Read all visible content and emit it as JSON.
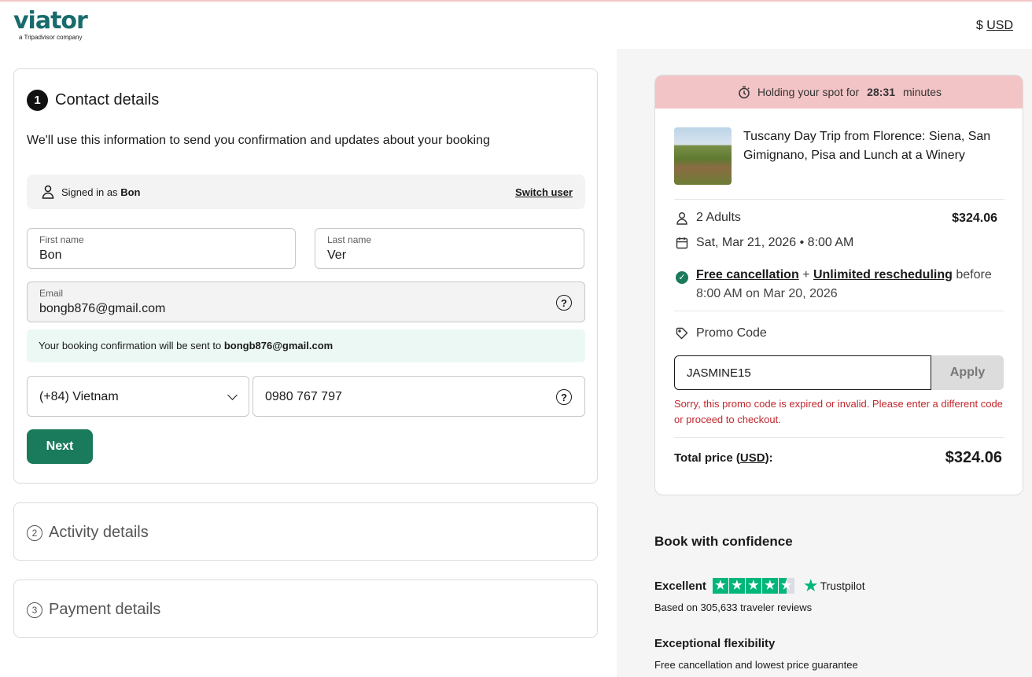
{
  "header": {
    "logo_text": "viator",
    "logo_sub": "a Tripadvisor company",
    "currency_symbol": "$",
    "currency_code": "USD"
  },
  "contact": {
    "step_number": "1",
    "title": "Contact details",
    "intro": "We'll use this information to send you confirmation and updates about your booking",
    "signed_in_prefix": "Signed in as",
    "signed_in_name": "Bon",
    "switch_user": "Switch user",
    "first_name_label": "First name",
    "first_name_value": "Bon",
    "last_name_label": "Last name",
    "last_name_value": "Ver",
    "email_label": "Email",
    "email_value": "bongb876@gmail.com",
    "notice_prefix": "Your booking confirmation will be sent to",
    "notice_email": "bongb876@gmail.com",
    "country_value": "(+84) Vietnam",
    "phone_value": "0980 767 797",
    "help_glyph": "?",
    "next_button": "Next"
  },
  "activity": {
    "step_number": "2",
    "title": "Activity details"
  },
  "payment": {
    "step_number": "3",
    "title": "Payment details"
  },
  "summary": {
    "hold_prefix": "Holding your spot for",
    "hold_timer": "28:31",
    "hold_suffix": "minutes",
    "tour_title": "Tuscany Day Trip from Florence: Siena, San Gimignano, Pisa and Lunch at a Winery",
    "travelers": "2 Adults",
    "travelers_price": "$324.06",
    "date": "Sat, Mar 21, 2026 • 8:00 AM",
    "free_cancellation": "Free cancellation",
    "plus": "+",
    "unlimited_rescheduling": "Unlimited rescheduling",
    "before": "before",
    "cancel_deadline": "8:00 AM on Mar 20, 2026",
    "promo_label": "Promo Code",
    "promo_value": "JASMINE15",
    "apply_button": "Apply",
    "promo_error": "Sorry, this promo code is expired or invalid. Please enter a different code or proceed to checkout.",
    "total_label_prefix": "Total price (",
    "total_label_currency": "USD",
    "total_label_suffix": "):",
    "total_value": "$324.06"
  },
  "confidence": {
    "title": "Book with confidence",
    "rating_word": "Excellent",
    "rating_stars": 4.5,
    "trustpilot": "Trustpilot",
    "reviews": "Based on 305,633 traveler reviews",
    "flex_title": "Exceptional flexibility",
    "flex_sub": "Free cancellation and lowest price guarantee"
  },
  "colors": {
    "brand_green": "#1a7a5c",
    "logo_teal": "#186b6d",
    "hold_banner": "#f3c4c6",
    "error_red": "#c0272d",
    "trustpilot_green": "#00b67a"
  }
}
